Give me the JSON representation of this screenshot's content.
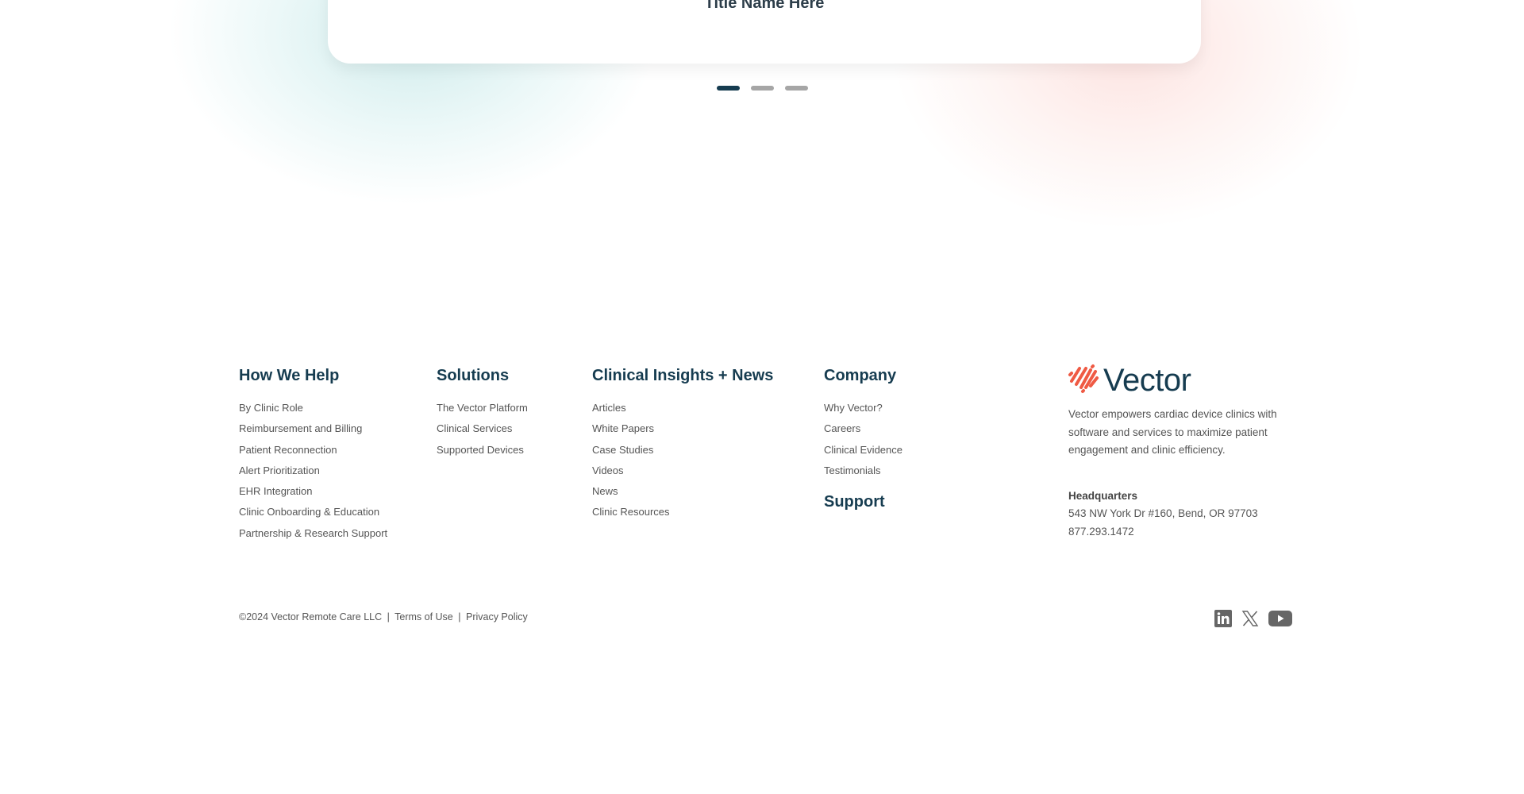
{
  "carousel": {
    "card_title": "Title Name Here",
    "slides_total": 3,
    "active_slide": 1
  },
  "footer": {
    "columns": [
      {
        "heading": "How We Help",
        "links": [
          "By Clinic Role",
          "Reimbursement and Billing",
          "Patient Reconnection",
          "Alert Prioritization",
          "EHR Integration",
          "Clinic Onboarding & Education",
          "Partnership & Research Support"
        ]
      },
      {
        "heading": "Solutions",
        "links": [
          "The Vector Platform",
          "Clinical Services",
          "Supported Devices"
        ]
      },
      {
        "heading": "Clinical Insights + News",
        "links": [
          "Articles",
          "White Papers",
          "Case Studies",
          "Videos",
          "News",
          "Clinic Resources"
        ]
      },
      {
        "heading": "Company",
        "links": [
          "Why Vector?",
          "Careers",
          "Clinical Evidence",
          "Testimonials"
        ],
        "extra_heading": "Support"
      }
    ],
    "brand": {
      "name": "Vector",
      "description": "Vector empowers cardiac device clinics with software and services to maximize patient engagement and clinic efficiency.",
      "hq_label": "Headquarters",
      "address": "543 NW York Dr #160, Bend, OR 97703",
      "phone": "877.293.1472",
      "logo_color": "#ef5a44",
      "text_color": "#163c50"
    },
    "bottom": {
      "copyright": "©2024 Vector Remote Care LLC",
      "separator": "|",
      "terms": "Terms of Use",
      "privacy": "Privacy Policy"
    },
    "social": [
      {
        "name": "linkedin-icon",
        "label": "LinkedIn"
      },
      {
        "name": "x-twitter-icon",
        "label": "X"
      },
      {
        "name": "youtube-icon",
        "label": "YouTube"
      }
    ]
  }
}
